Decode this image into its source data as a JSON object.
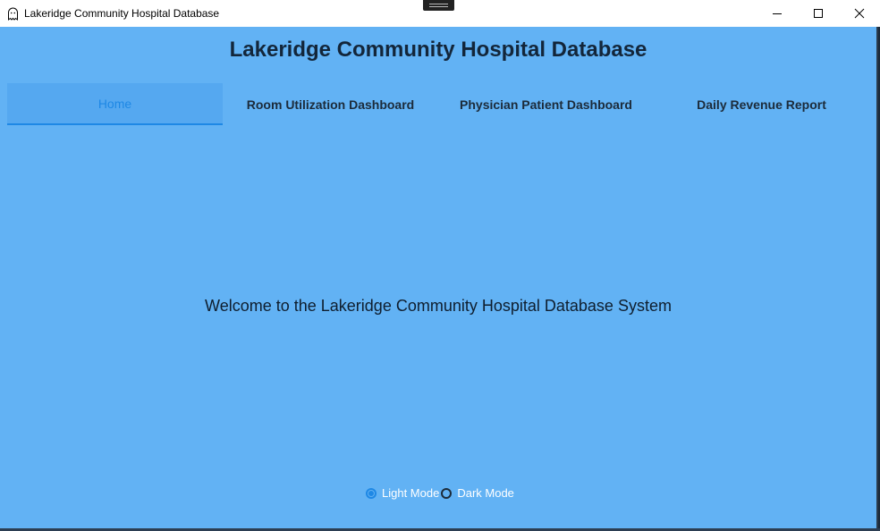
{
  "window": {
    "title": "Lakeridge Community Hospital Database",
    "icon": "ghost-icon",
    "controls": [
      "minimize-icon",
      "maximize-icon",
      "close-icon"
    ]
  },
  "app": {
    "heading": "Lakeridge Community Hospital Database",
    "tabs": [
      {
        "label": "Home",
        "active": true
      },
      {
        "label": "Room Utilization Dashboard",
        "active": false
      },
      {
        "label": "Physician Patient Dashboard",
        "active": false
      },
      {
        "label": "Daily Revenue Report",
        "active": false
      }
    ],
    "welcome": "Welcome to the Lakeridge Community Hospital Database System",
    "theme_options": {
      "light_label": "Light Mode",
      "dark_label": "Dark Mode",
      "selected": "Light Mode"
    }
  },
  "colors": {
    "background": "#62b2f4",
    "accent": "#1e88e5",
    "text": "#13263a"
  }
}
